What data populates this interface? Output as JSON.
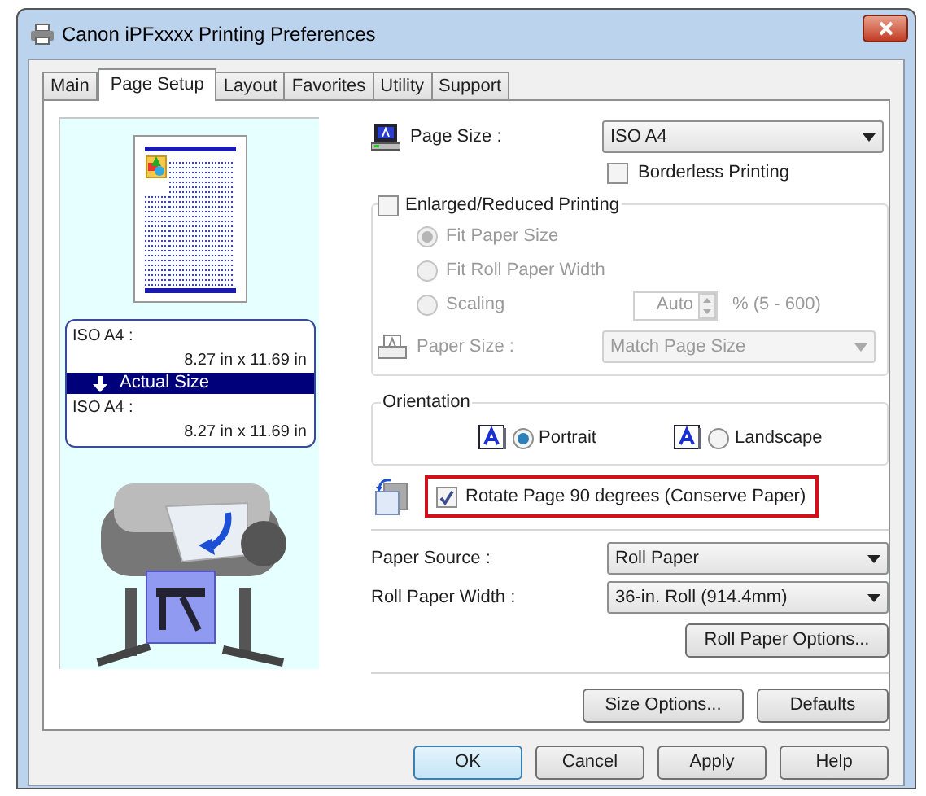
{
  "window": {
    "title": "Canon iPFxxxx Printing Preferences"
  },
  "tabs": [
    {
      "label": "Main",
      "selected": false
    },
    {
      "label": "Page Setup",
      "selected": true
    },
    {
      "label": "Layout",
      "selected": false
    },
    {
      "label": "Favorites",
      "selected": false
    },
    {
      "label": "Utility",
      "selected": false
    },
    {
      "label": "Support",
      "selected": false
    }
  ],
  "preview": {
    "original": {
      "name": "ISO A4 :",
      "dims": "8.27 in x 11.69 in"
    },
    "mode": "Actual Size",
    "output": {
      "name": "ISO A4 :",
      "dims": "8.27 in x 11.69 in"
    }
  },
  "page_size": {
    "label": "Page Size :",
    "value": "ISO A4"
  },
  "borderless": {
    "label": "Borderless Printing",
    "checked": false
  },
  "enlarged": {
    "label": "Enlarged/Reduced Printing",
    "checked": false,
    "disabled": true,
    "options": [
      {
        "label": "Fit Paper Size",
        "selected": true
      },
      {
        "label": "Fit Roll Paper Width",
        "selected": false
      },
      {
        "label": "Scaling",
        "selected": false
      }
    ],
    "scaling": {
      "value": "Auto",
      "range": "% (5 - 600)"
    },
    "paper_size": {
      "label": "Paper Size :",
      "value": "Match Page Size"
    }
  },
  "orientation": {
    "title": "Orientation",
    "options": [
      {
        "label": "Portrait",
        "selected": true
      },
      {
        "label": "Landscape",
        "selected": false
      }
    ]
  },
  "rotate": {
    "label": "Rotate Page 90 degrees (Conserve Paper)",
    "checked": true,
    "highlighted": true
  },
  "paper_source": {
    "label": "Paper Source :",
    "value": "Roll Paper"
  },
  "roll_width": {
    "label": "Roll Paper Width :",
    "value": "36-in. Roll (914.4mm)"
  },
  "roll_options_button": "Roll Paper Options...",
  "size_options_button": "Size Options...",
  "defaults_button": "Defaults",
  "dialog_buttons": [
    {
      "label": "OK",
      "default": true
    },
    {
      "label": "Cancel",
      "default": false
    },
    {
      "label": "Apply",
      "default": false
    },
    {
      "label": "Help",
      "default": false
    }
  ]
}
